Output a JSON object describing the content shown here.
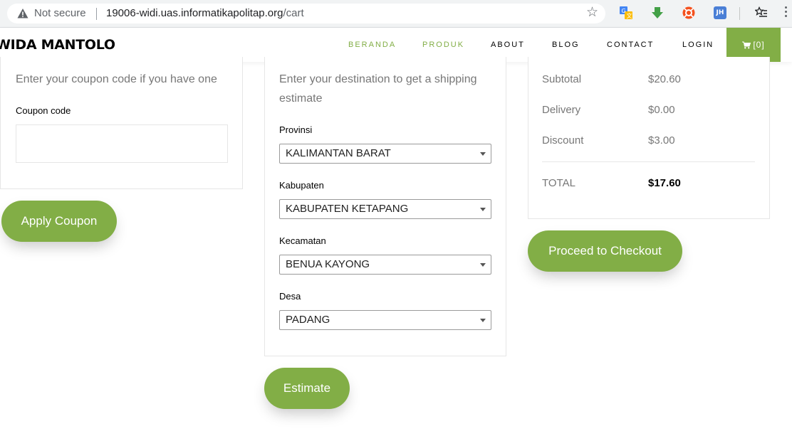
{
  "browser": {
    "security_label": "Not secure",
    "url_host": "19006-widi.uas.informatikapolitap.org",
    "url_path": "/cart",
    "extensions": [
      "translate-extension-icon",
      "download-extension-icon",
      "orange-extension-icon",
      "jh-extension-icon"
    ],
    "jh_label": "JH"
  },
  "header": {
    "brand": "WIDA MANTOLO",
    "nav": [
      {
        "label": "BERANDA"
      },
      {
        "label": "PRODUK"
      },
      {
        "label": "ABOUT"
      },
      {
        "label": "BLOG"
      },
      {
        "label": "CONTACT"
      },
      {
        "label": "LOGIN"
      }
    ],
    "cart_label": "[0]",
    "accent_color": "#82ae46"
  },
  "coupon": {
    "description": "Enter your coupon code if you have one",
    "field_label": "Coupon code",
    "field_value": "",
    "button_label": "Apply Coupon"
  },
  "shipping": {
    "description": "Enter your destination to get a shipping estimate",
    "provinsi_label": "Provinsi",
    "provinsi_value": "KALIMANTAN BARAT",
    "kabupaten_label": "Kabupaten",
    "kabupaten_value": "KABUPATEN KETAPANG",
    "kecamatan_label": "Kecamatan",
    "kecamatan_value": "BENUA KAYONG",
    "desa_label": "Desa",
    "desa_value": "PADANG",
    "button_label": "Estimate"
  },
  "totals": {
    "subtotal_label": "Subtotal",
    "subtotal_value": "$20.60",
    "delivery_label": "Delivery",
    "delivery_value": "$0.00",
    "discount_label": "Discount",
    "discount_value": "$3.00",
    "total_label": "TOTAL",
    "total_value": "$17.60",
    "checkout_label": "Proceed to Checkout"
  }
}
